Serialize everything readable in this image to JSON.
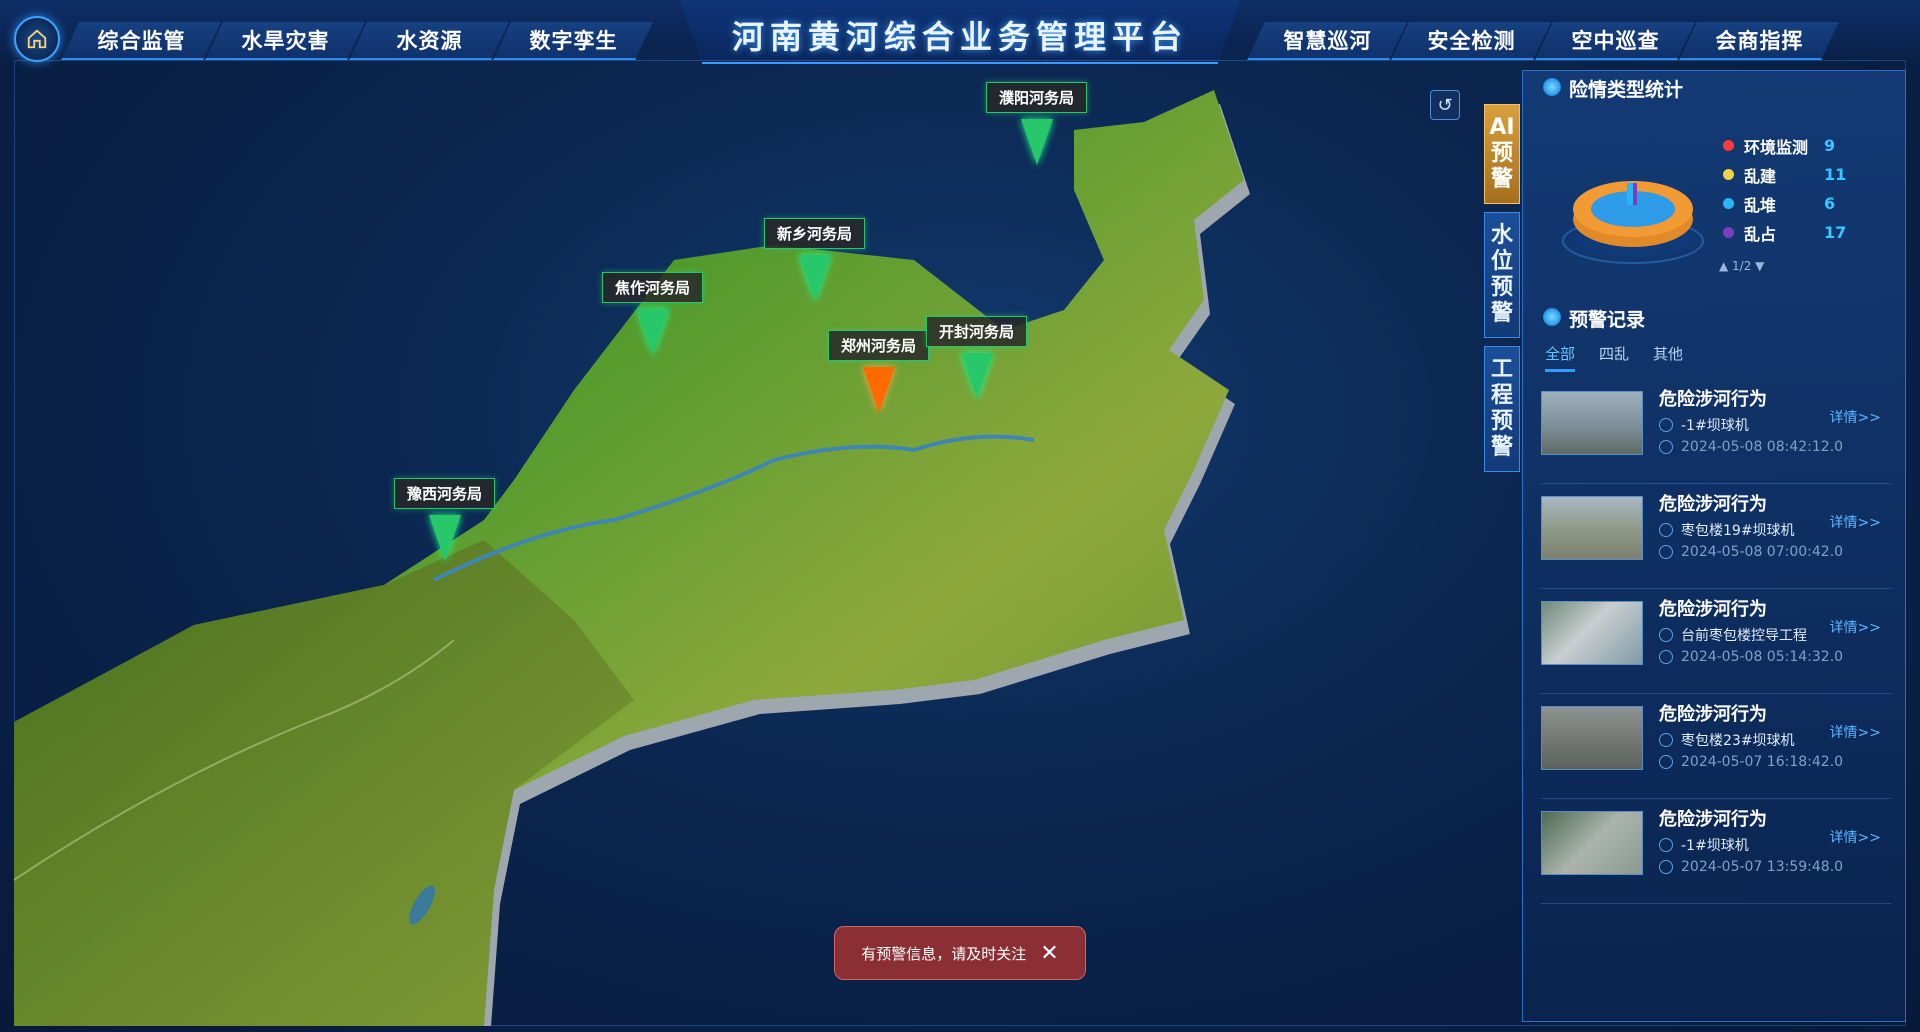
{
  "header": {
    "title": "河南黄河综合业务管理平台",
    "left_tabs": [
      "综合监管",
      "水旱灾害",
      "水资源",
      "数字孪生"
    ],
    "right_tabs": [
      "智慧巡河",
      "安全检测",
      "空中巡查",
      "会商指挥"
    ]
  },
  "map": {
    "markers": [
      {
        "label": "濮阳河务局",
        "color": "green"
      },
      {
        "label": "新乡河务局",
        "color": "green"
      },
      {
        "label": "焦作河务局",
        "color": "green"
      },
      {
        "label": "郑州河务局",
        "color": "orange"
      },
      {
        "label": "开封河务局",
        "color": "green"
      },
      {
        "label": "豫西河务局",
        "color": "green"
      }
    ],
    "refresh_icon": "refresh-icon"
  },
  "side_tabs": [
    "AI预警",
    "水位预警",
    "工程预警"
  ],
  "toast": {
    "message": "有预警信息，请及时关注",
    "close": "✕"
  },
  "stats": {
    "title": "险情类型统计",
    "legend": [
      {
        "label": "环境监测",
        "value": "9",
        "color": "#ff3b3b"
      },
      {
        "label": "乱建",
        "value": "11",
        "color": "#f2d04a"
      },
      {
        "label": "乱堆",
        "value": "6",
        "color": "#29b6f6"
      },
      {
        "label": "乱占",
        "value": "17",
        "color": "#7a3fbf"
      }
    ],
    "pager": "▲ 1/2 ▼"
  },
  "warnings": {
    "title": "预警记录",
    "tabs": [
      "全部",
      "四乱",
      "其他"
    ],
    "detail_label": "详情>>",
    "records": [
      {
        "title": "危险涉河行为",
        "location": "-1#坝球机",
        "time": "2024-05-08 08:42:12.0"
      },
      {
        "title": "危险涉河行为",
        "location": "枣包楼19#坝球机",
        "time": "2024-05-08 07:00:42.0"
      },
      {
        "title": "危险涉河行为",
        "location": "台前枣包楼控导工程",
        "time": "2024-05-08 05:14:32.0"
      },
      {
        "title": "危险涉河行为",
        "location": "枣包楼23#坝球机",
        "time": "2024-05-07 16:18:42.0"
      },
      {
        "title": "危险涉河行为",
        "location": "-1#坝球机",
        "time": "2024-05-07 13:59:48.0"
      }
    ]
  }
}
